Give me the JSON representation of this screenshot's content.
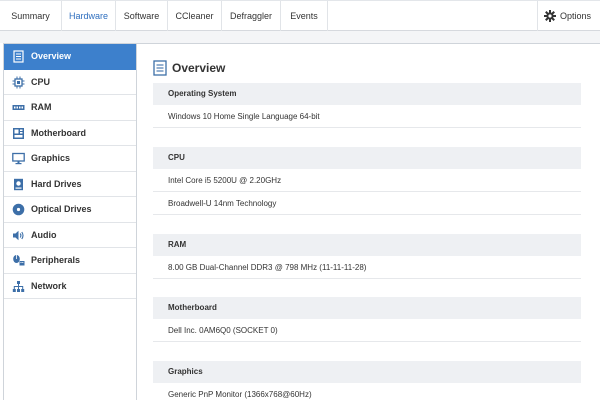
{
  "tabs": [
    {
      "label": "Summary",
      "active": false
    },
    {
      "label": "Hardware",
      "active": true
    },
    {
      "label": "Software",
      "active": false
    },
    {
      "label": "CCleaner",
      "active": false
    },
    {
      "label": "Defraggler",
      "active": false
    },
    {
      "label": "Events",
      "active": false
    }
  ],
  "options": {
    "label": "Options",
    "icon": "gear-icon"
  },
  "sidebar": {
    "items": [
      {
        "label": "Overview",
        "icon": "document-icon",
        "active": true
      },
      {
        "label": "CPU",
        "icon": "cpu-icon",
        "active": false
      },
      {
        "label": "RAM",
        "icon": "ram-icon",
        "active": false
      },
      {
        "label": "Motherboard",
        "icon": "motherboard-icon",
        "active": false
      },
      {
        "label": "Graphics",
        "icon": "monitor-icon",
        "active": false
      },
      {
        "label": "Hard Drives",
        "icon": "hard-drive-icon",
        "active": false
      },
      {
        "label": "Optical Drives",
        "icon": "disc-icon",
        "active": false
      },
      {
        "label": "Audio",
        "icon": "speaker-icon",
        "active": false
      },
      {
        "label": "Peripherals",
        "icon": "peripherals-icon",
        "active": false
      },
      {
        "label": "Network",
        "icon": "network-icon",
        "active": false
      }
    ]
  },
  "main": {
    "title": "Overview",
    "sections": [
      {
        "header": "Operating System",
        "rows": [
          "Windows 10 Home Single Language 64-bit"
        ]
      },
      {
        "header": "CPU",
        "rows": [
          "Intel Core i5 5200U @ 2.20GHz",
          "Broadwell-U 14nm Technology"
        ]
      },
      {
        "header": "RAM",
        "rows": [
          "8.00 GB Dual-Channel DDR3 @ 798 MHz (11-11-11-28)"
        ]
      },
      {
        "header": "Motherboard",
        "rows": [
          "Dell Inc. 0AM6Q0 (SOCKET 0)"
        ]
      },
      {
        "header": "Graphics",
        "rows": [
          "Generic PnP Monitor (1366x768@60Hz)"
        ]
      }
    ]
  },
  "colors": {
    "accent": "#3d80cc",
    "active_tab_text": "#2f6fbf",
    "section_header_bg": "#eef0f3"
  }
}
